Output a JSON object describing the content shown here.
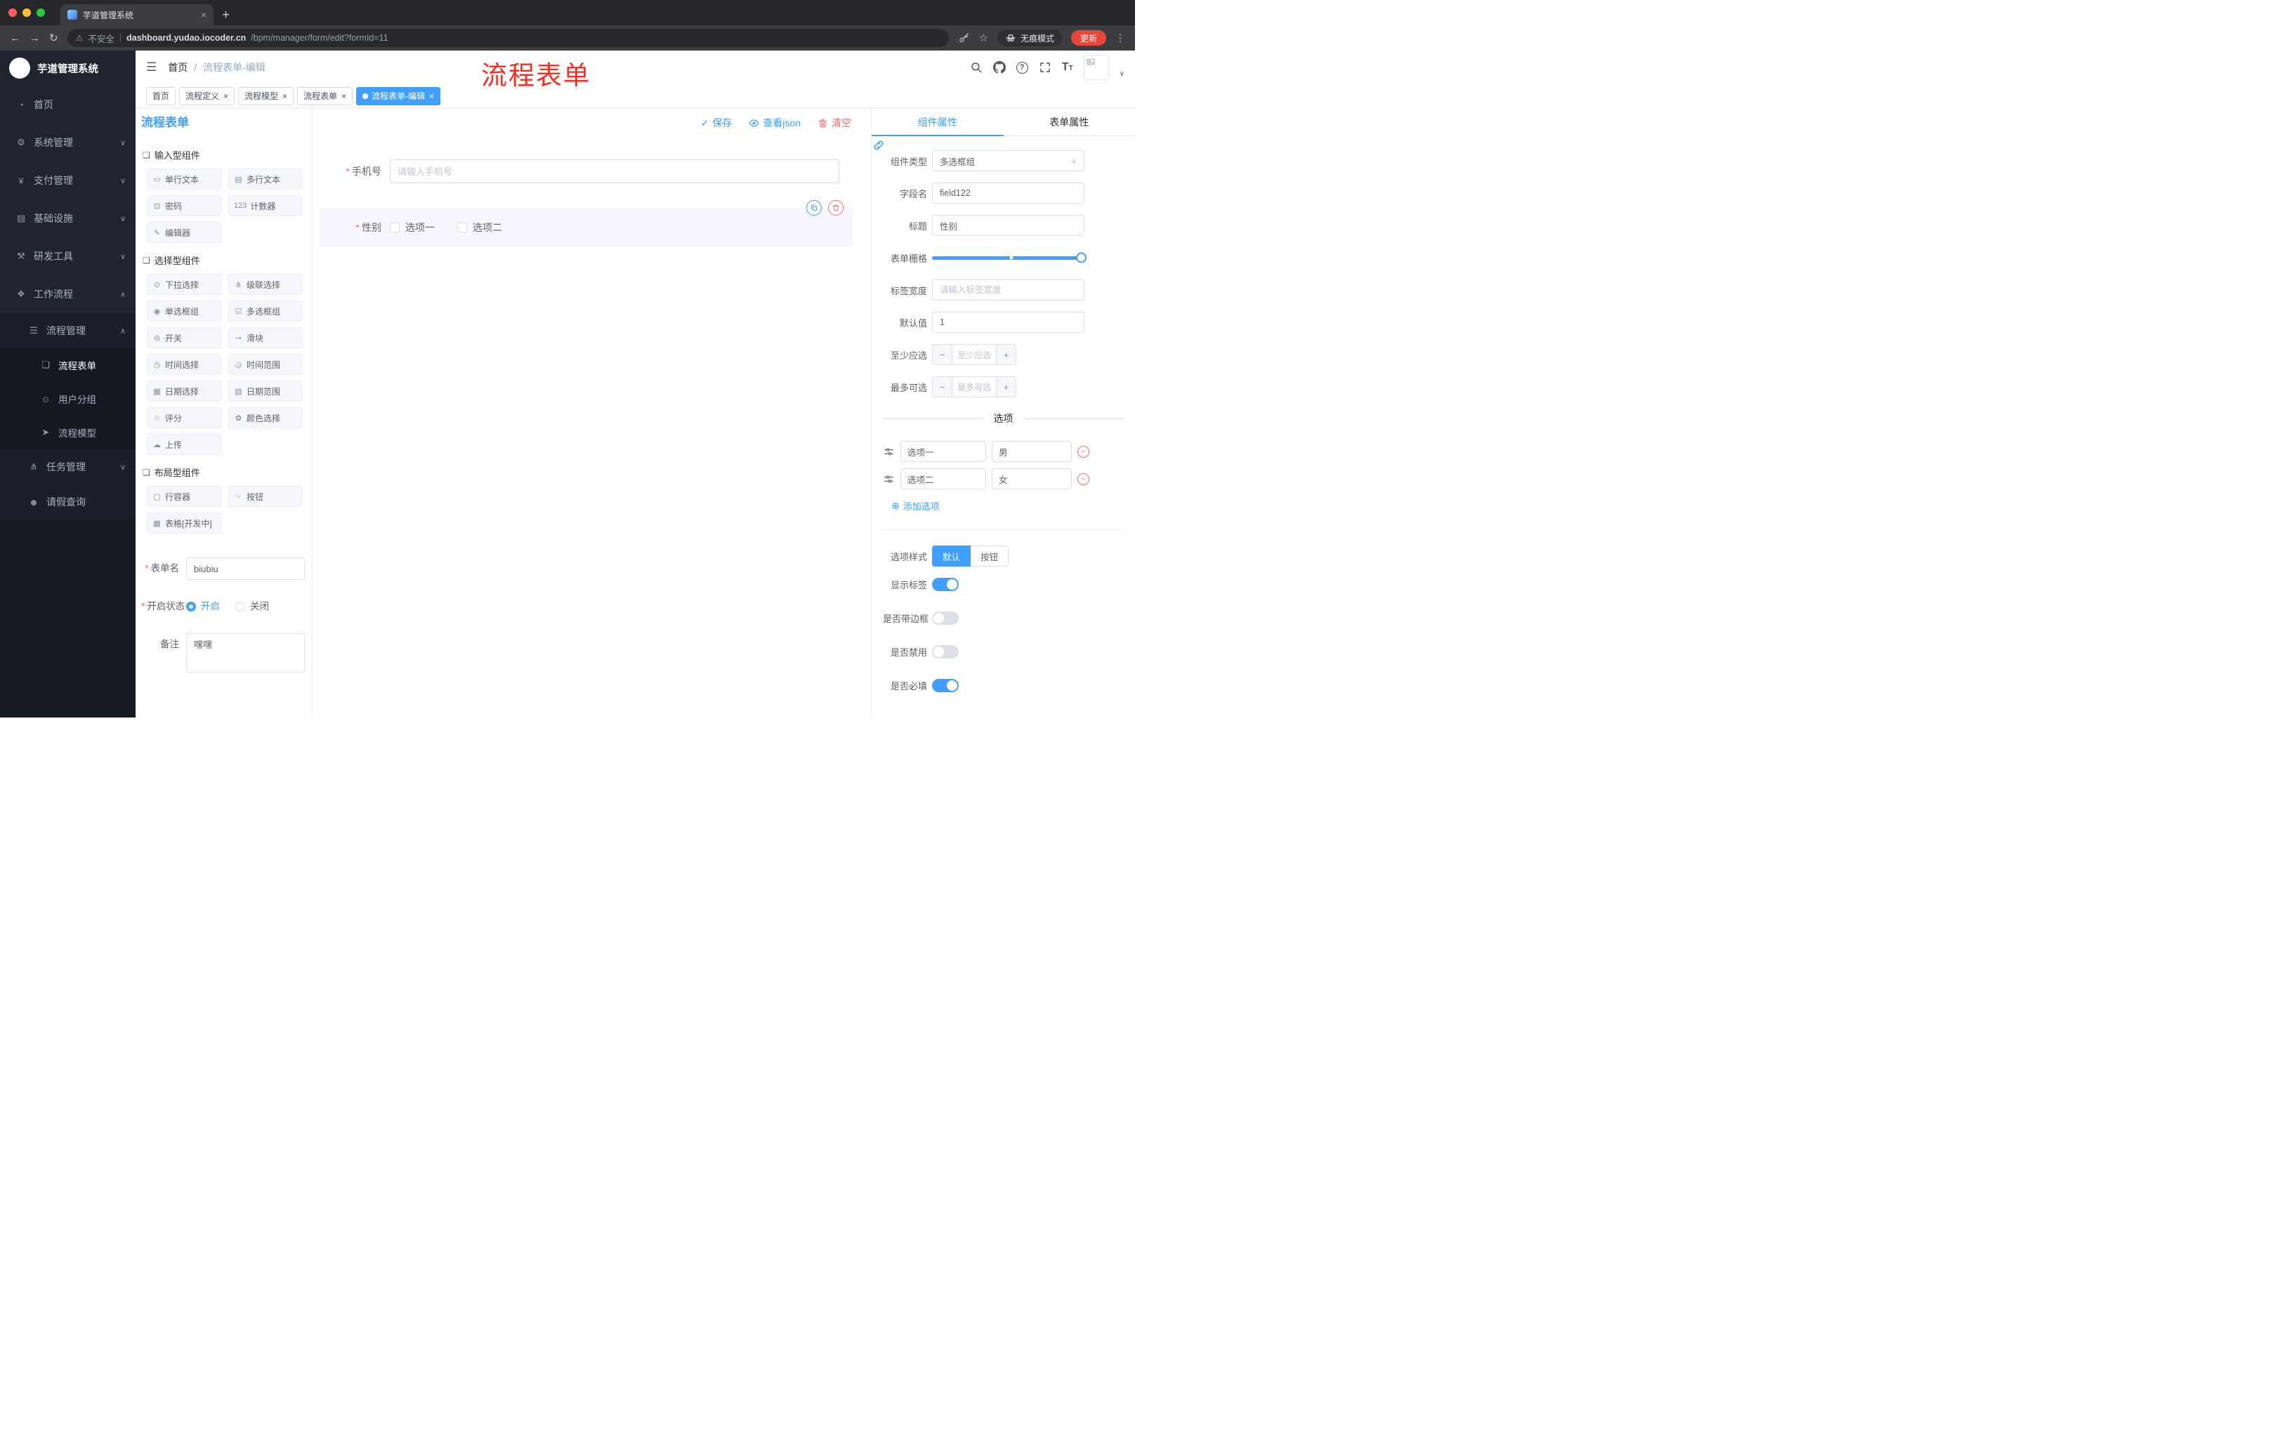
{
  "colors": {
    "primary": "#409eff",
    "danger": "#f56c6c",
    "annotation": "#fb2b1d",
    "sidebar_bg": "#1f242e"
  },
  "icons": {
    "close": "×",
    "plus": "+",
    "minus": "−",
    "check": "✓",
    "back": "←",
    "forward": "→",
    "reload": "↻",
    "warning": "⚠",
    "dots": "⋮",
    "star": "☆",
    "chevron_down": "∨",
    "chevron_up": "∧",
    "question": "?",
    "hamburger": "☰",
    "group": "❏",
    "plus_circle": "⊕",
    "asterisk": "*",
    "separator": "|",
    "font_large": "T",
    "font_small": "T"
  },
  "annotation": {
    "text": "流程表单"
  },
  "browser": {
    "tab_title": "芋道管理系统",
    "address": {
      "security": "不安全",
      "separator": "|",
      "host": "dashboard.yudao.iocoder.cn",
      "path": "/bpm/manager/form/edit?formId=11"
    },
    "incognito_label": "无痕模式",
    "update_label": "更新"
  },
  "sidebar": {
    "title": "芋道管理系统",
    "menu": [
      {
        "label": "首页",
        "icon": "◔"
      },
      {
        "label": "系统管理",
        "icon": "⚙"
      },
      {
        "label": "支付管理",
        "icon": "¥"
      },
      {
        "label": "基础设施",
        "icon": "▤"
      },
      {
        "label": "研发工具",
        "icon": "⚒"
      },
      {
        "label": "工作流程",
        "icon": "❖"
      }
    ],
    "submenu": [
      {
        "label": "流程管理",
        "icon": "☰"
      },
      {
        "label": "流程表单",
        "icon": "❏"
      },
      {
        "label": "用户分组",
        "icon": "☺"
      },
      {
        "label": "流程模型",
        "icon": "➤"
      },
      {
        "label": "任务管理",
        "icon": "⋔"
      },
      {
        "label": "请假查询",
        "icon": "☻"
      }
    ]
  },
  "header": {
    "breadcrumb": [
      "首页",
      "流程表单-编辑"
    ],
    "sep": "/"
  },
  "tags": [
    {
      "label": "首页",
      "closable": false,
      "active": false
    },
    {
      "label": "流程定义",
      "closable": true,
      "active": false
    },
    {
      "label": "流程模型",
      "closable": true,
      "active": false
    },
    {
      "label": "流程表单",
      "closable": true,
      "active": false
    },
    {
      "label": "流程表单-编辑",
      "closable": true,
      "active": true
    }
  ],
  "palette": {
    "title": "流程表单",
    "groups": [
      {
        "title": "输入型组件",
        "items": [
          {
            "label": "单行文本",
            "icon": "▭"
          },
          {
            "label": "多行文本",
            "icon": "▤"
          },
          {
            "label": "密码",
            "icon": "⊡"
          },
          {
            "label": "计数器",
            "icon": "123"
          },
          {
            "label": "编辑器",
            "icon": "✎"
          }
        ]
      },
      {
        "title": "选择型组件",
        "items": [
          {
            "label": "下拉选择",
            "icon": "⊙"
          },
          {
            "label": "级联选择",
            "icon": "⋔"
          },
          {
            "label": "单选框组",
            "icon": "◉"
          },
          {
            "label": "多选框组",
            "icon": "☑"
          },
          {
            "label": "开关",
            "icon": "⊖"
          },
          {
            "label": "滑块",
            "icon": "⊸"
          },
          {
            "label": "时间选择",
            "icon": "◷"
          },
          {
            "label": "时间范围",
            "icon": "◶"
          },
          {
            "label": "日期选择",
            "icon": "▦"
          },
          {
            "label": "日期范围",
            "icon": "▧"
          },
          {
            "label": "评分",
            "icon": "☆"
          },
          {
            "label": "颜色选择",
            "icon": "✿"
          },
          {
            "label": "上传",
            "icon": "☁"
          }
        ]
      },
      {
        "title": "布局型组件",
        "items": [
          {
            "label": "行容器",
            "icon": "▢"
          },
          {
            "label": "按钮",
            "icon": "☞"
          },
          {
            "label": "表格[开发中]",
            "icon": "▩"
          }
        ]
      }
    ],
    "form": {
      "name_label": "表单名",
      "name_value": "biubiu",
      "status_label": "开启状态",
      "status_on": "开启",
      "status_off": "关闭",
      "remark_label": "备注",
      "remark_value": "嘿嘿"
    }
  },
  "canvas": {
    "toolbar": {
      "save": "保存",
      "view_json": "查看json",
      "clear": "清空"
    },
    "fields": [
      {
        "label": "手机号",
        "required": true,
        "placeholder": "请输入手机号"
      },
      {
        "label": "性别",
        "required": true,
        "selected": true,
        "options": [
          "选项一",
          "选项二"
        ]
      }
    ]
  },
  "inspector": {
    "tabs": [
      "组件属性",
      "表单属性"
    ],
    "rows": {
      "component_type": {
        "label": "组件类型",
        "value": "多选框组"
      },
      "field_name": {
        "label": "字段名",
        "value": "field122"
      },
      "title": {
        "label": "标题",
        "value": "性别"
      },
      "grid": {
        "label": "表单栅格"
      },
      "label_width": {
        "label": "标签宽度",
        "placeholder": "请输入标签宽度"
      },
      "default_value": {
        "label": "默认值",
        "value": "1"
      },
      "min_select": {
        "label": "至少应选",
        "placeholder": "至少应选"
      },
      "max_select": {
        "label": "最多可选",
        "placeholder": "最多可选"
      }
    },
    "options_divider": "选项",
    "options": [
      {
        "label": "选项一",
        "value": "男"
      },
      {
        "label": "选项二",
        "value": "女"
      }
    ],
    "add_option": "添加选项",
    "option_style": {
      "label": "选项样式",
      "choices": [
        "默认",
        "按钮"
      ],
      "active": 0
    },
    "switches": [
      {
        "label": "显示标签",
        "on": true
      },
      {
        "label": "是否带边框",
        "on": false
      },
      {
        "label": "是否禁用",
        "on": false
      },
      {
        "label": "是否必填",
        "on": true
      }
    ]
  }
}
